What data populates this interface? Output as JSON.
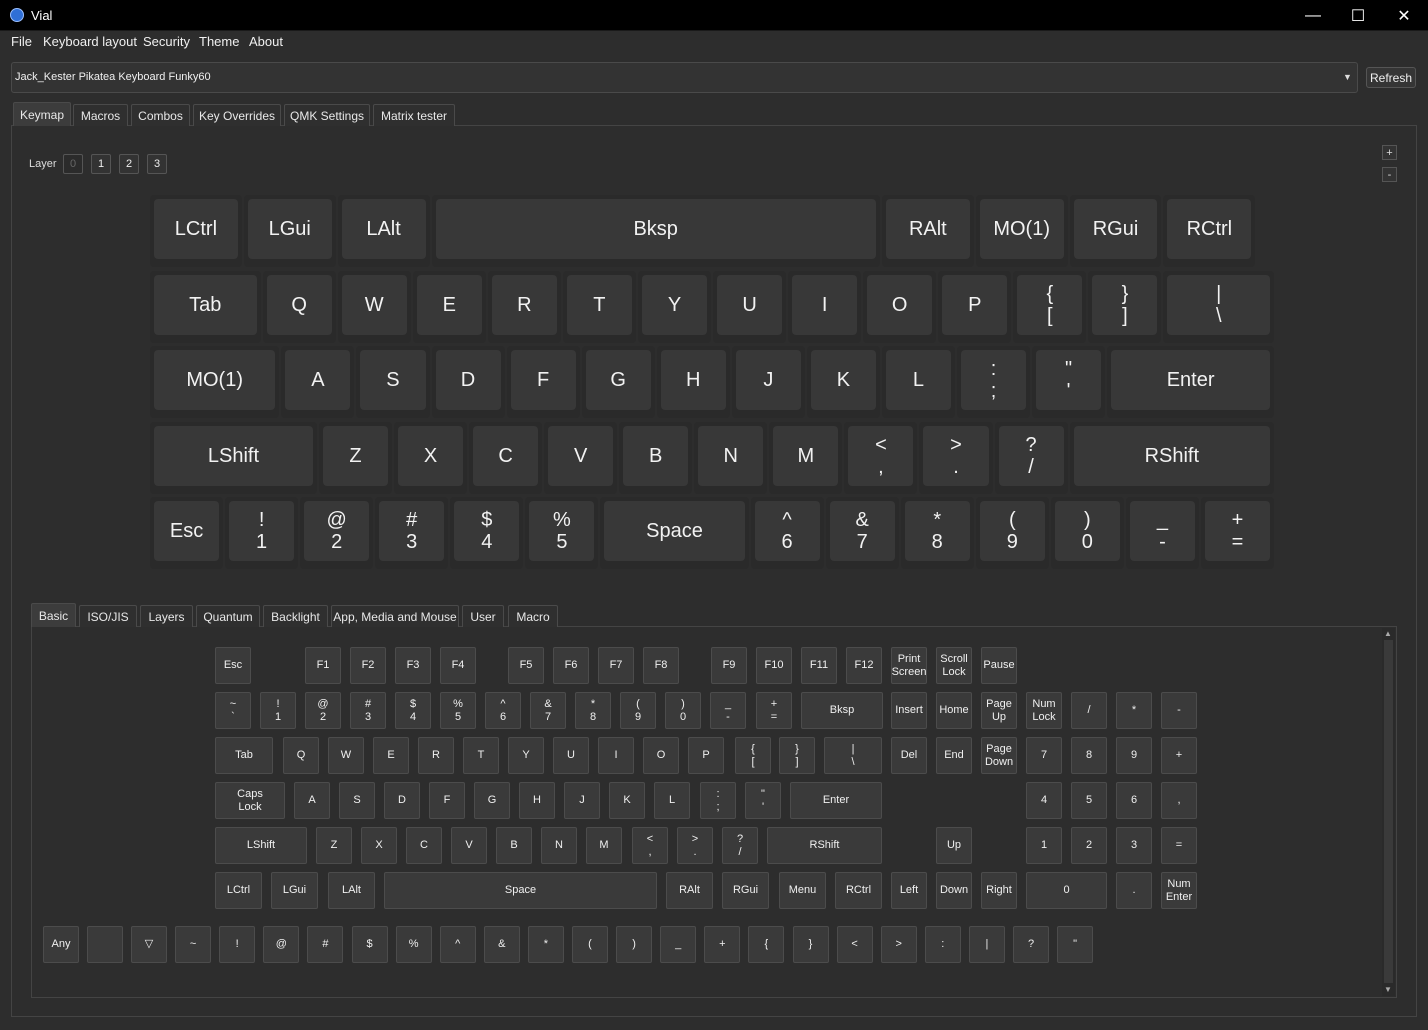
{
  "window": {
    "title": "Vial",
    "minimize": "—",
    "maximize": "☐",
    "close": "✕"
  },
  "menu": [
    "File",
    "Keyboard layout",
    "Security",
    "Theme",
    "About"
  ],
  "keyboard_select": {
    "value": "Jack_Kester Pikatea Keyboard Funky60",
    "arrow": "▼"
  },
  "refresh_label": "Refresh",
  "main_tabs": [
    "Keymap",
    "Macros",
    "Combos",
    "Key Overrides",
    "QMK Settings",
    "Matrix tester"
  ],
  "layer": {
    "label": "Layer",
    "buttons": [
      "0",
      "1",
      "2",
      "3"
    ],
    "selected": "0"
  },
  "zoom": {
    "plus": "+",
    "minus": "-"
  },
  "keymap_rows": [
    [
      [
        "LCtrl"
      ],
      [
        "LGui"
      ],
      [
        "LAlt"
      ],
      [
        "Bksp"
      ],
      [
        "RAlt"
      ],
      [
        "MO(1)"
      ],
      [
        "RGui"
      ],
      [
        "RCtrl"
      ]
    ],
    [
      [
        "Tab"
      ],
      [
        "Q"
      ],
      [
        "W"
      ],
      [
        "E"
      ],
      [
        "R"
      ],
      [
        "T"
      ],
      [
        "Y"
      ],
      [
        "U"
      ],
      [
        "I"
      ],
      [
        "O"
      ],
      [
        "P"
      ],
      [
        "{",
        "["
      ],
      [
        "}",
        "]"
      ],
      [
        "|",
        "\\"
      ]
    ],
    [
      [
        "MO(1)"
      ],
      [
        "A"
      ],
      [
        "S"
      ],
      [
        "D"
      ],
      [
        "F"
      ],
      [
        "G"
      ],
      [
        "H"
      ],
      [
        "J"
      ],
      [
        "K"
      ],
      [
        "L"
      ],
      [
        ":",
        ";"
      ],
      [
        "\"",
        "'"
      ],
      [
        "Enter"
      ]
    ],
    [
      [
        "LShift"
      ],
      [
        "Z"
      ],
      [
        "X"
      ],
      [
        "C"
      ],
      [
        "V"
      ],
      [
        "B"
      ],
      [
        "N"
      ],
      [
        "M"
      ],
      [
        "<",
        ","
      ],
      [
        ">",
        "."
      ],
      [
        "?",
        "/"
      ],
      [
        "RShift"
      ]
    ],
    [
      [
        "Esc"
      ],
      [
        "!",
        "1"
      ],
      [
        "@",
        "2"
      ],
      [
        "#",
        "3"
      ],
      [
        "$",
        "4"
      ],
      [
        "%",
        "5"
      ],
      [
        "Space"
      ],
      [
        "^",
        "6"
      ],
      [
        "&",
        "7"
      ],
      [
        "*",
        "8"
      ],
      [
        "(",
        "9"
      ],
      [
        ")",
        "0"
      ],
      [
        "_",
        "-"
      ],
      [
        "+",
        "="
      ]
    ]
  ],
  "bottom_tabs": [
    "Basic",
    "ISO/JIS",
    "Layers",
    "Quantum",
    "Backlight",
    "App, Media and Mouse",
    "User",
    "Macro"
  ],
  "basic_rows": [
    [
      [
        "Esc"
      ],
      [
        "F1"
      ],
      [
        "F2"
      ],
      [
        "F3"
      ],
      [
        "F4"
      ],
      [
        "F5"
      ],
      [
        "F6"
      ],
      [
        "F7"
      ],
      [
        "F8"
      ],
      [
        "F9"
      ],
      [
        "F10"
      ],
      [
        "F11"
      ],
      [
        "F12"
      ],
      [
        "Print",
        "Screen"
      ],
      [
        "Scroll",
        "Lock"
      ],
      [
        "Pause"
      ]
    ],
    [
      [
        "~",
        "`"
      ],
      [
        "!",
        "1"
      ],
      [
        "@",
        "2"
      ],
      [
        "#",
        "3"
      ],
      [
        "$",
        "4"
      ],
      [
        "%",
        "5"
      ],
      [
        "^",
        "6"
      ],
      [
        "&",
        "7"
      ],
      [
        "*",
        "8"
      ],
      [
        "(",
        "9"
      ],
      [
        ")",
        "0"
      ],
      [
        "_",
        "-"
      ],
      [
        "+",
        "="
      ],
      [
        "Bksp"
      ],
      [
        "Insert"
      ],
      [
        "Home"
      ],
      [
        "Page",
        "Up"
      ],
      [
        "Num",
        "Lock"
      ],
      [
        "/"
      ],
      [
        "*"
      ],
      [
        "-"
      ]
    ],
    [
      [
        "Tab"
      ],
      [
        "Q"
      ],
      [
        "W"
      ],
      [
        "E"
      ],
      [
        "R"
      ],
      [
        "T"
      ],
      [
        "Y"
      ],
      [
        "U"
      ],
      [
        "I"
      ],
      [
        "O"
      ],
      [
        "P"
      ],
      [
        "{",
        "["
      ],
      [
        "}",
        "]"
      ],
      [
        "|",
        "\\"
      ],
      [
        "Del"
      ],
      [
        "End"
      ],
      [
        "Page",
        "Down"
      ],
      [
        "7"
      ],
      [
        "8"
      ],
      [
        "9"
      ],
      [
        "+"
      ]
    ],
    [
      [
        "Caps",
        "Lock"
      ],
      [
        "A"
      ],
      [
        "S"
      ],
      [
        "D"
      ],
      [
        "F"
      ],
      [
        "G"
      ],
      [
        "H"
      ],
      [
        "J"
      ],
      [
        "K"
      ],
      [
        "L"
      ],
      [
        ":",
        ";"
      ],
      [
        "\"",
        "'"
      ],
      [
        "Enter"
      ],
      [
        "4"
      ],
      [
        "5"
      ],
      [
        "6"
      ],
      [
        ","
      ]
    ],
    [
      [
        "LShift"
      ],
      [
        "Z"
      ],
      [
        "X"
      ],
      [
        "C"
      ],
      [
        "V"
      ],
      [
        "B"
      ],
      [
        "N"
      ],
      [
        "M"
      ],
      [
        "<",
        ","
      ],
      [
        ">",
        "."
      ],
      [
        "?",
        "/"
      ],
      [
        "RShift"
      ],
      [
        "Up"
      ],
      [
        "1"
      ],
      [
        "2"
      ],
      [
        "3"
      ],
      [
        "="
      ]
    ],
    [
      [
        "LCtrl"
      ],
      [
        "LGui"
      ],
      [
        "LAlt"
      ],
      [
        "Space"
      ],
      [
        "RAlt"
      ],
      [
        "RGui"
      ],
      [
        "Menu"
      ],
      [
        "RCtrl"
      ],
      [
        "Left"
      ],
      [
        "Down"
      ],
      [
        "Right"
      ],
      [
        "0"
      ],
      [
        "."
      ],
      [
        "Num",
        "Enter"
      ]
    ]
  ],
  "extra_keys": [
    [
      "Any"
    ],
    [
      ""
    ],
    [
      "▽"
    ],
    [
      "~"
    ],
    [
      "!"
    ],
    [
      "@"
    ],
    [
      "#"
    ],
    [
      "$"
    ],
    [
      "%"
    ],
    [
      "^"
    ],
    [
      "&"
    ],
    [
      "*"
    ],
    [
      "("
    ],
    [
      ")"
    ],
    [
      "_"
    ],
    [
      "+"
    ],
    [
      "{"
    ],
    [
      "}"
    ],
    [
      "<"
    ],
    [
      ">"
    ],
    [
      ":"
    ],
    [
      "|"
    ],
    [
      "?"
    ],
    [
      "\""
    ]
  ],
  "scroll": {
    "up": "▲",
    "down": "▼"
  }
}
